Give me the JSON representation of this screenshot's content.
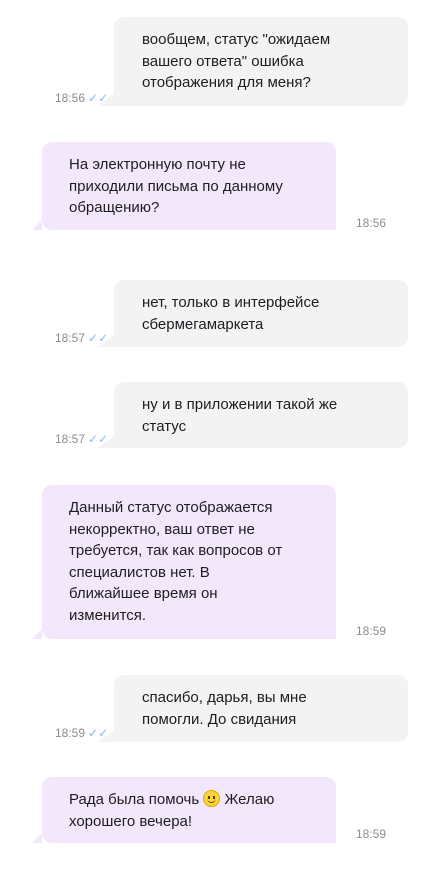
{
  "messages": [
    {
      "sender": "user",
      "time": "18:56",
      "lines": [
        "вообщем, статус \"ожидаем",
        "вашего ответа\" ошибка",
        "отображения для меня?"
      ]
    },
    {
      "sender": "agent",
      "time": "18:56",
      "lines": [
        "На электронную почту не",
        "приходили письма по данному",
        "обращению?"
      ]
    },
    {
      "sender": "user",
      "time": "18:57",
      "lines": [
        "нет, только в интерфейсе",
        "сбермегамаркета"
      ]
    },
    {
      "sender": "user",
      "time": "18:57",
      "lines": [
        "ну и в приложении такой же",
        "статус"
      ]
    },
    {
      "sender": "agent",
      "time": "18:59",
      "lines": [
        "Данный статус отображается",
        "некорректно, ваш ответ не",
        "требуется, так как вопросов от",
        "специалистов нет. В",
        "ближайшее время он",
        "изменится."
      ]
    },
    {
      "sender": "user",
      "time": "18:59",
      "lines": [
        "спасибо, дарья, вы мне",
        "помогли. До свидания"
      ]
    },
    {
      "sender": "agent",
      "time": "18:59",
      "line1_before": "Рада была помочь",
      "emoji": "smiling-face-emoji",
      "line1_after": "Желаю",
      "line2": "хорошего вечера!"
    }
  ],
  "read_status_icon": "double-check-icon",
  "colors": {
    "user_bubble": "#f3f3f4",
    "agent_bubble": "#f3e8fb",
    "read_check": "#8fb3ff",
    "time_text": "#8c8c94"
  }
}
